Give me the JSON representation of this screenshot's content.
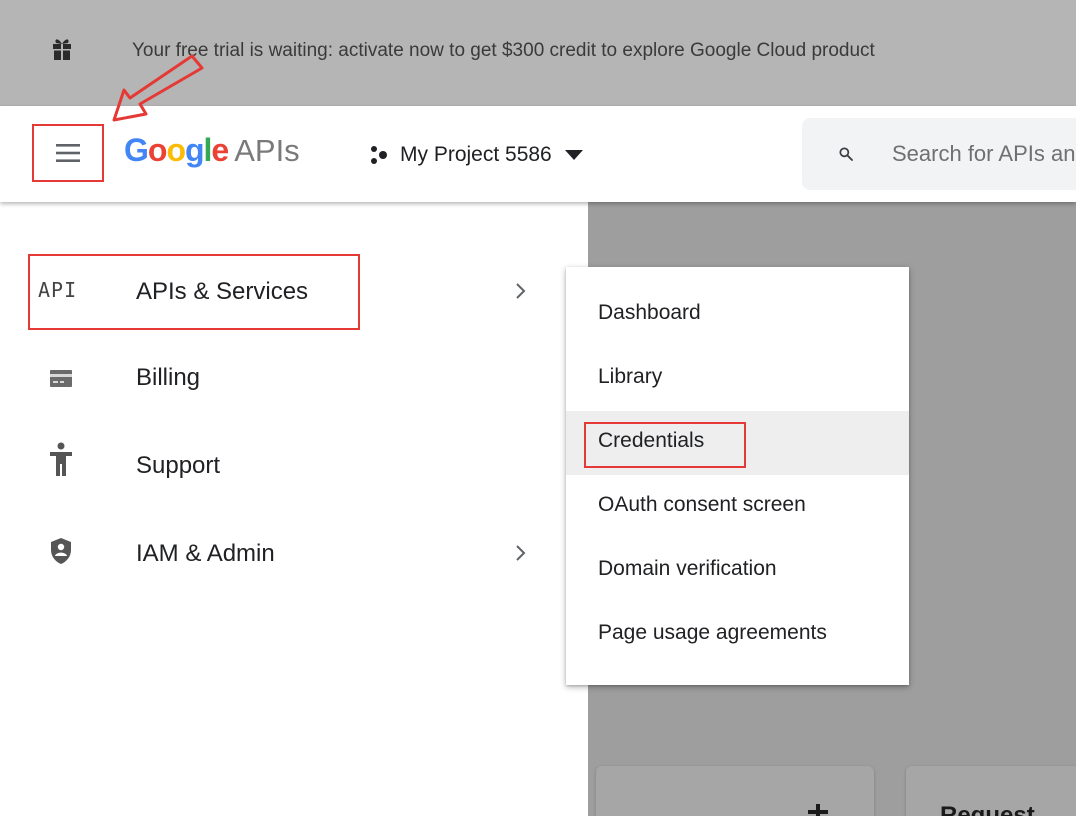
{
  "banner": {
    "text": "Your free trial is waiting: activate now to get $300 credit to explore Google Cloud product",
    "icon": "gift-icon"
  },
  "header": {
    "menu_icon": "hamburger-menu-icon",
    "logo_brand": "Google",
    "logo_suffix": "APIs",
    "project_icon": "project-dots-icon",
    "project_name": "My Project 5586",
    "project_caret_icon": "caret-down-icon",
    "search_icon": "search-icon",
    "search_placeholder": "Search for APIs and Services"
  },
  "sidebar": {
    "items": [
      {
        "label": "APIs & Services",
        "icon_text": "API",
        "icon": "api-icon",
        "has_submenu": true
      },
      {
        "label": "Billing",
        "icon": "billing-card-icon",
        "has_submenu": false
      },
      {
        "label": "Support",
        "icon": "support-person-icon",
        "has_submenu": false
      },
      {
        "label": "IAM & Admin",
        "icon": "shield-user-icon",
        "has_submenu": true
      }
    ]
  },
  "submenu": {
    "items": [
      {
        "label": "Dashboard"
      },
      {
        "label": "Library"
      },
      {
        "label": "Credentials",
        "active": true
      },
      {
        "label": "OAuth consent screen"
      },
      {
        "label": "Domain verification"
      },
      {
        "label": "Page usage agreements"
      }
    ]
  },
  "background": {
    "card_title": "Request"
  },
  "colors": {
    "google_blue": "#4285F4",
    "google_red": "#EA4335",
    "google_yellow": "#FBBC05",
    "google_green": "#34A853",
    "annotation_red": "#E53935",
    "banner_bg": "#B5B5B5",
    "backdrop": "#9E9E9E"
  }
}
